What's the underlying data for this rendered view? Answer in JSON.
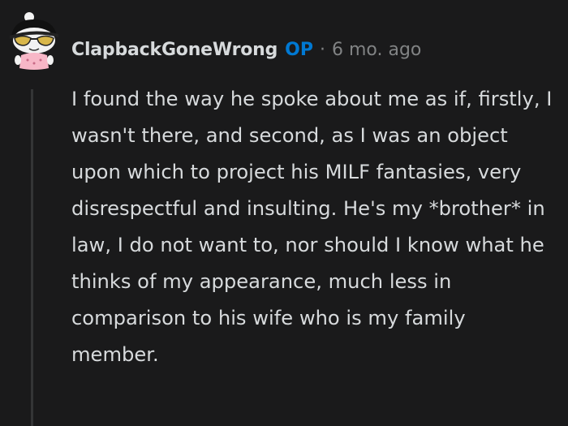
{
  "comment": {
    "author": "ClapbackGoneWrong",
    "op_badge": "OP",
    "separator": "·",
    "age": "6 mo. ago",
    "body": "I found the way he spoke about me as if, firstly, I wasn't there, and second, as I was an object upon which to project his MILF fantasies, very disrespectful and insulting. He's my *brother* in law, I do not want to, nor should I know what he thinks of my appearance, much less in comparison to his wife who is my family member."
  },
  "colors": {
    "background": "#1a1a1b",
    "text": "#d7dadc",
    "muted": "#818384",
    "op_accent": "#0079d3",
    "thread_line": "#343536"
  },
  "icons": {
    "avatar": "snoo-avatar-icon"
  }
}
